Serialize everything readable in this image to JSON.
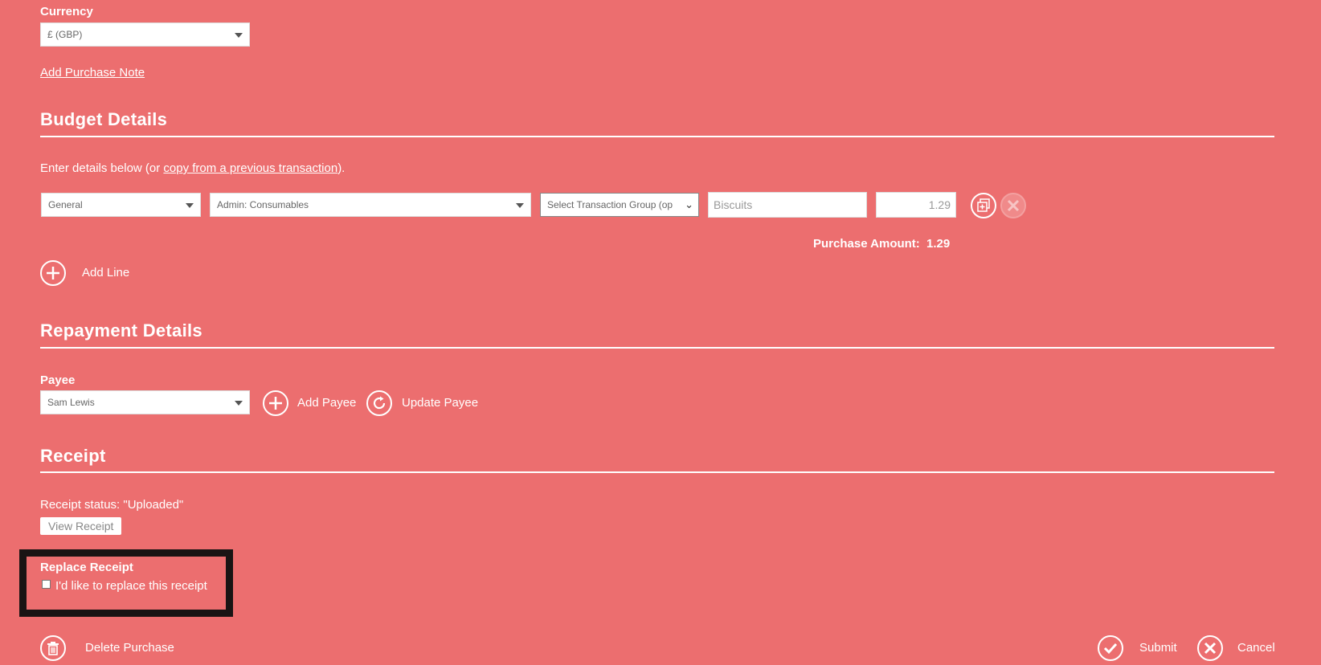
{
  "currency": {
    "label": "Currency",
    "value": "£ (GBP)"
  },
  "purchase_note_link": "Add Purchase Note",
  "budget": {
    "heading": "Budget Details",
    "intro_prefix": "Enter details below (or ",
    "intro_link": "copy from a previous transaction",
    "intro_suffix": ").",
    "line": {
      "category": "General",
      "account": "Admin: Consumables",
      "group": "Select Transaction Group (op",
      "description": "Biscuits",
      "amount": "1.29"
    },
    "purchase_amount_label": "Purchase Amount:",
    "purchase_amount_value": "1.29",
    "add_line_label": "Add Line"
  },
  "repayment": {
    "heading": "Repayment Details",
    "payee_label": "Payee",
    "payee_value": "Sam Lewis",
    "add_payee": "Add Payee",
    "update_payee": "Update Payee"
  },
  "receipt": {
    "heading": "Receipt",
    "status": "Receipt status: \"Uploaded\"",
    "view_button": "View Receipt",
    "replace_label": "Replace Receipt",
    "replace_checkbox": "I'd like to replace this receipt"
  },
  "footer": {
    "delete": "Delete Purchase",
    "submit": "Submit",
    "cancel": "Cancel"
  }
}
